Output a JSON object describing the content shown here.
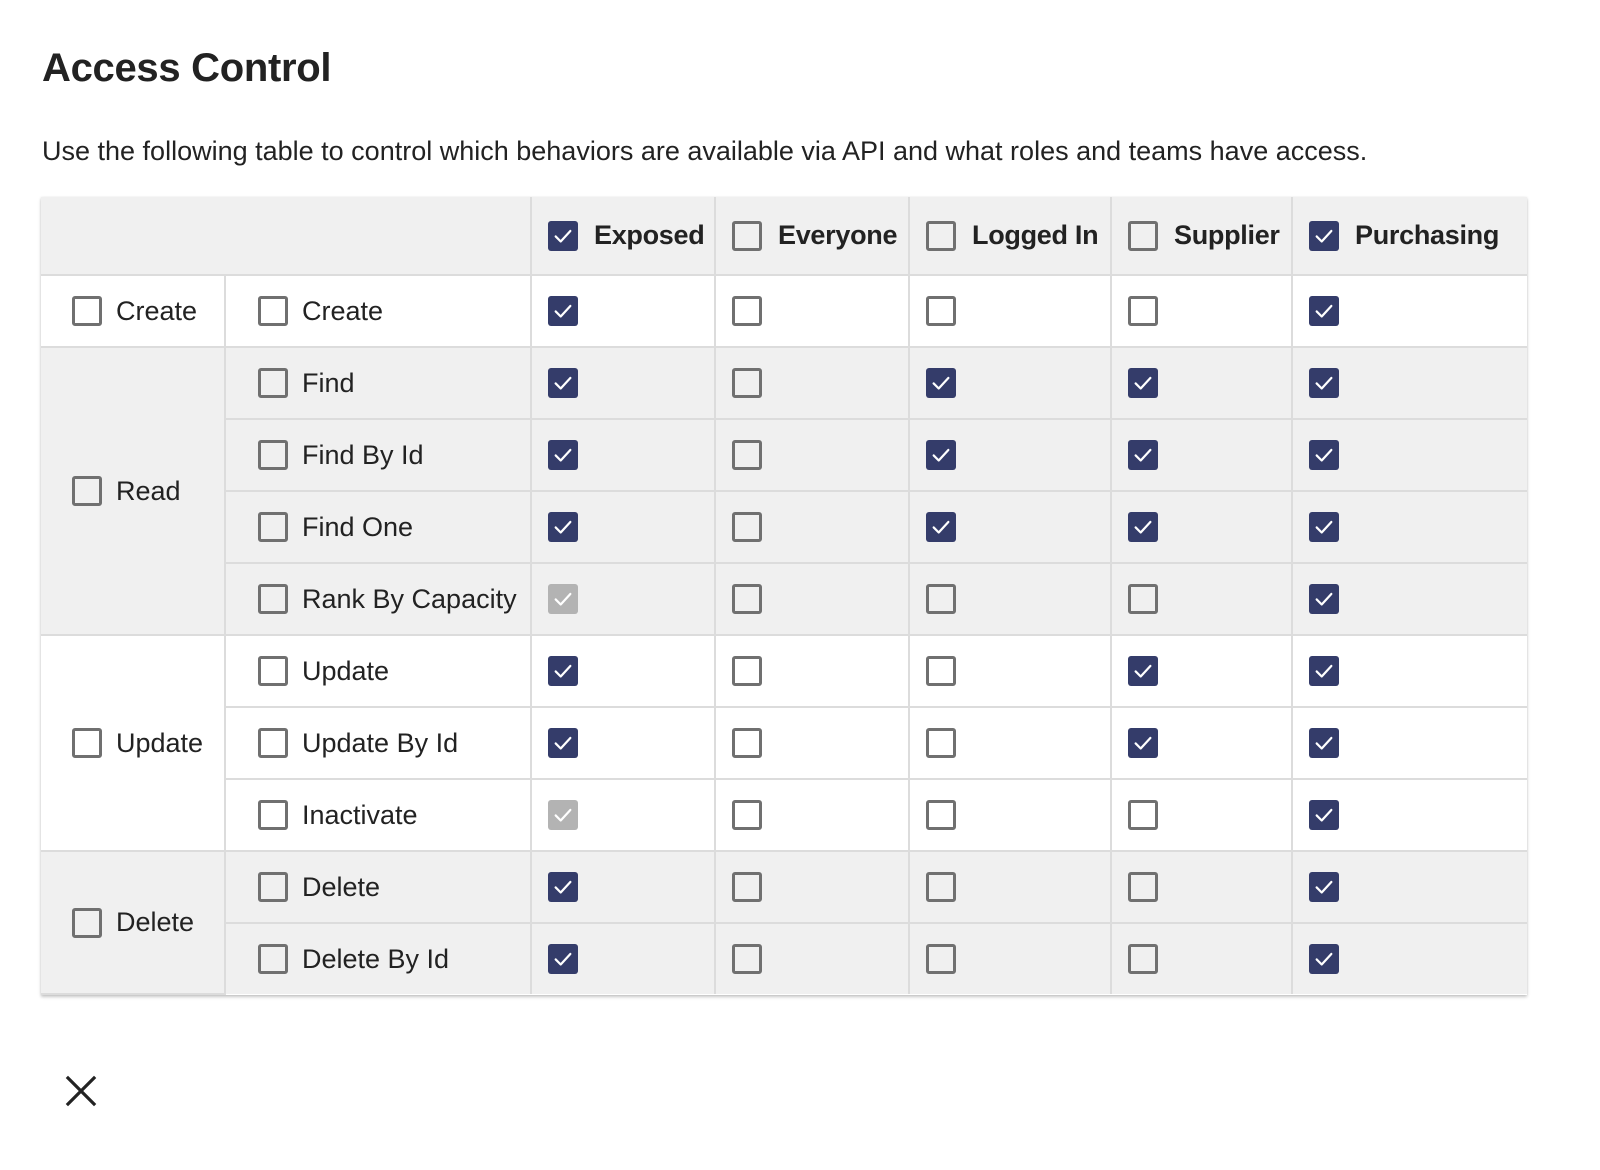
{
  "page": {
    "title": "Access Control",
    "description": "Use the following table to control which behaviors are available via API and what roles and teams have access."
  },
  "colors": {
    "checked": "#343c6a",
    "disabled_checked": "#b3b3b3",
    "unchecked_border": "#707070",
    "header_bg": "#f0f0f0",
    "alt_row_bg": "#f0f0f0",
    "grid_line": "#dcdcdc"
  },
  "table": {
    "columns": [
      {
        "key": "exposed",
        "label": "Exposed",
        "checked": true
      },
      {
        "key": "everyone",
        "label": "Everyone",
        "checked": false
      },
      {
        "key": "logged_in",
        "label": "Logged In",
        "checked": false
      },
      {
        "key": "supplier",
        "label": "Supplier",
        "checked": false
      },
      {
        "key": "purchasing",
        "label": "Purchasing",
        "checked": true
      }
    ],
    "groups": [
      {
        "label": "Create",
        "checked": false,
        "operations": [
          {
            "label": "Create",
            "checked": false,
            "cells": [
              "on",
              "off",
              "off",
              "off",
              "on"
            ]
          }
        ]
      },
      {
        "label": "Read",
        "checked": false,
        "operations": [
          {
            "label": "Find",
            "checked": false,
            "cells": [
              "on",
              "off",
              "on",
              "on",
              "on"
            ]
          },
          {
            "label": "Find By Id",
            "checked": false,
            "cells": [
              "on",
              "off",
              "on",
              "on",
              "on"
            ]
          },
          {
            "label": "Find One",
            "checked": false,
            "cells": [
              "on",
              "off",
              "on",
              "on",
              "on"
            ]
          },
          {
            "label": "Rank By Capacity",
            "checked": false,
            "cells": [
              "disabled",
              "off",
              "off",
              "off",
              "on"
            ]
          }
        ]
      },
      {
        "label": "Update",
        "checked": false,
        "operations": [
          {
            "label": "Update",
            "checked": false,
            "cells": [
              "on",
              "off",
              "off",
              "on",
              "on"
            ]
          },
          {
            "label": "Update By Id",
            "checked": false,
            "cells": [
              "on",
              "off",
              "off",
              "on",
              "on"
            ]
          },
          {
            "label": "Inactivate",
            "checked": false,
            "cells": [
              "disabled",
              "off",
              "off",
              "off",
              "on"
            ]
          }
        ]
      },
      {
        "label": "Delete",
        "checked": false,
        "operations": [
          {
            "label": "Delete",
            "checked": false,
            "cells": [
              "on",
              "off",
              "off",
              "off",
              "on"
            ]
          },
          {
            "label": "Delete By Id",
            "checked": false,
            "cells": [
              "on",
              "off",
              "off",
              "off",
              "on"
            ]
          }
        ]
      }
    ]
  },
  "footer": {
    "close_icon": "close-x-icon"
  }
}
